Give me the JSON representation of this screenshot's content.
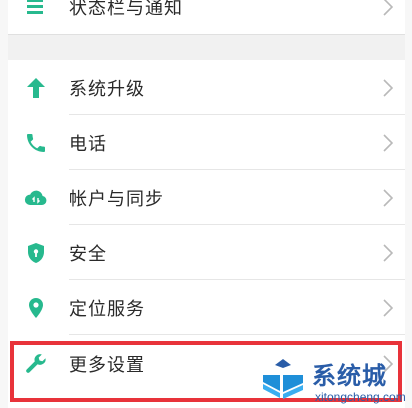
{
  "colors": {
    "accent": "#27b98e",
    "highlight_border": "#e8333a",
    "watermark_blue": "#2a5da8"
  },
  "top_group": {
    "items": [
      {
        "label": "状态栏与通知",
        "icon": "notification-icon"
      }
    ]
  },
  "settings_list": {
    "items": [
      {
        "label": "系统升级",
        "icon": "arrow-up-icon"
      },
      {
        "label": "电话",
        "icon": "phone-icon"
      },
      {
        "label": "帐户与同步",
        "icon": "cloud-sync-icon"
      },
      {
        "label": "安全",
        "icon": "shield-icon"
      },
      {
        "label": "定位服务",
        "icon": "location-pin-icon"
      },
      {
        "label": "更多设置",
        "icon": "wrench-icon"
      }
    ]
  },
  "watermark": {
    "title": "系统城",
    "url": "xitongcheng.com"
  }
}
